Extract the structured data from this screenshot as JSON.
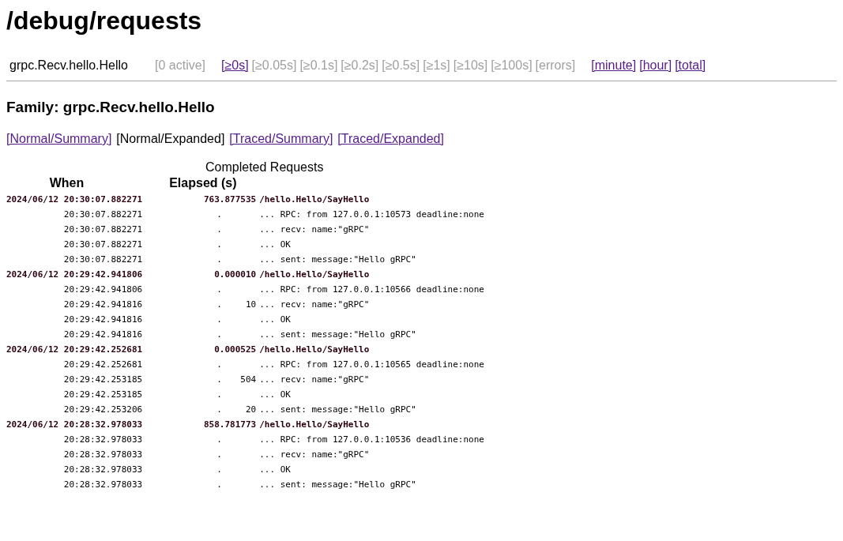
{
  "title": "/debug/requests",
  "header": {
    "family": "grpc.Recv.hello.Hello",
    "active": "[0 active]",
    "buckets": [
      {
        "text": "[≥0s]",
        "disabled": false
      },
      {
        "text": "[≥0.05s]",
        "disabled": true
      },
      {
        "text": "[≥0.1s]",
        "disabled": true
      },
      {
        "text": "[≥0.2s]",
        "disabled": true
      },
      {
        "text": "[≥0.5s]",
        "disabled": true
      },
      {
        "text": "[≥1s]",
        "disabled": true
      },
      {
        "text": "[≥10s]",
        "disabled": true
      },
      {
        "text": "[≥100s]",
        "disabled": true
      },
      {
        "text": "[errors]",
        "disabled": true
      }
    ],
    "periods": [
      "[minute]",
      "[hour]",
      "[total]"
    ]
  },
  "family_heading": "Family: grpc.Recv.hello.Hello",
  "views": [
    {
      "text": "[Normal/Summary]",
      "selected": false
    },
    {
      "text": "[Normal/Expanded]",
      "selected": true
    },
    {
      "text": "[Traced/Summary]",
      "selected": false
    },
    {
      "text": "[Traced/Expanded]",
      "selected": false
    }
  ],
  "table": {
    "caption": "Completed Requests",
    "columns": [
      "When",
      "Elapsed (s)"
    ],
    "rows": [
      {
        "kind": "request",
        "when": "2024/06/12 20:30:07.882271",
        "elapsed": "763.877535",
        "text": "/hello.Hello/SayHello"
      },
      {
        "kind": "event",
        "when": "20:30:07.882271",
        "elapsed": ".",
        "text": "... RPC: from 127.0.0.1:10573 deadline:none"
      },
      {
        "kind": "event",
        "when": "20:30:07.882271",
        "elapsed": ".",
        "text": "... recv: name:\"gRPC\""
      },
      {
        "kind": "event",
        "when": "20:30:07.882271",
        "elapsed": ".",
        "text": "... OK"
      },
      {
        "kind": "event",
        "when": "20:30:07.882271",
        "elapsed": ".",
        "text": "... sent: message:\"Hello gRPC\""
      },
      {
        "kind": "request",
        "when": "2024/06/12 20:29:42.941806",
        "elapsed": "0.000010",
        "text": "/hello.Hello/SayHello"
      },
      {
        "kind": "event",
        "when": "20:29:42.941806",
        "elapsed": ".",
        "text": "... RPC: from 127.0.0.1:10566 deadline:none"
      },
      {
        "kind": "event",
        "when": "20:29:42.941816",
        "elapsed": ".",
        "delta": "10",
        "text": "... recv: name:\"gRPC\""
      },
      {
        "kind": "event",
        "when": "20:29:42.941816",
        "elapsed": ".",
        "text": "... OK"
      },
      {
        "kind": "event",
        "when": "20:29:42.941816",
        "elapsed": ".",
        "text": "... sent: message:\"Hello gRPC\""
      },
      {
        "kind": "request",
        "when": "2024/06/12 20:29:42.252681",
        "elapsed": "0.000525",
        "text": "/hello.Hello/SayHello"
      },
      {
        "kind": "event",
        "when": "20:29:42.252681",
        "elapsed": ".",
        "text": "... RPC: from 127.0.0.1:10565 deadline:none"
      },
      {
        "kind": "event",
        "when": "20:29:42.253185",
        "elapsed": ".",
        "delta": "504",
        "text": "... recv: name:\"gRPC\""
      },
      {
        "kind": "event",
        "when": "20:29:42.253185",
        "elapsed": ".",
        "text": "... OK"
      },
      {
        "kind": "event",
        "when": "20:29:42.253206",
        "elapsed": ".",
        "delta": "20",
        "text": "... sent: message:\"Hello gRPC\""
      },
      {
        "kind": "request",
        "when": "2024/06/12 20:28:32.978033",
        "elapsed": "858.781773",
        "text": "/hello.Hello/SayHello"
      },
      {
        "kind": "event",
        "when": "20:28:32.978033",
        "elapsed": ".",
        "text": "... RPC: from 127.0.0.1:10536 deadline:none"
      },
      {
        "kind": "event",
        "when": "20:28:32.978033",
        "elapsed": ".",
        "text": "... recv: name:\"gRPC\""
      },
      {
        "kind": "event",
        "when": "20:28:32.978033",
        "elapsed": ".",
        "text": "... OK"
      },
      {
        "kind": "event",
        "when": "20:28:32.978033",
        "elapsed": ".",
        "text": "... sent: message:\"Hello gRPC\""
      }
    ]
  }
}
